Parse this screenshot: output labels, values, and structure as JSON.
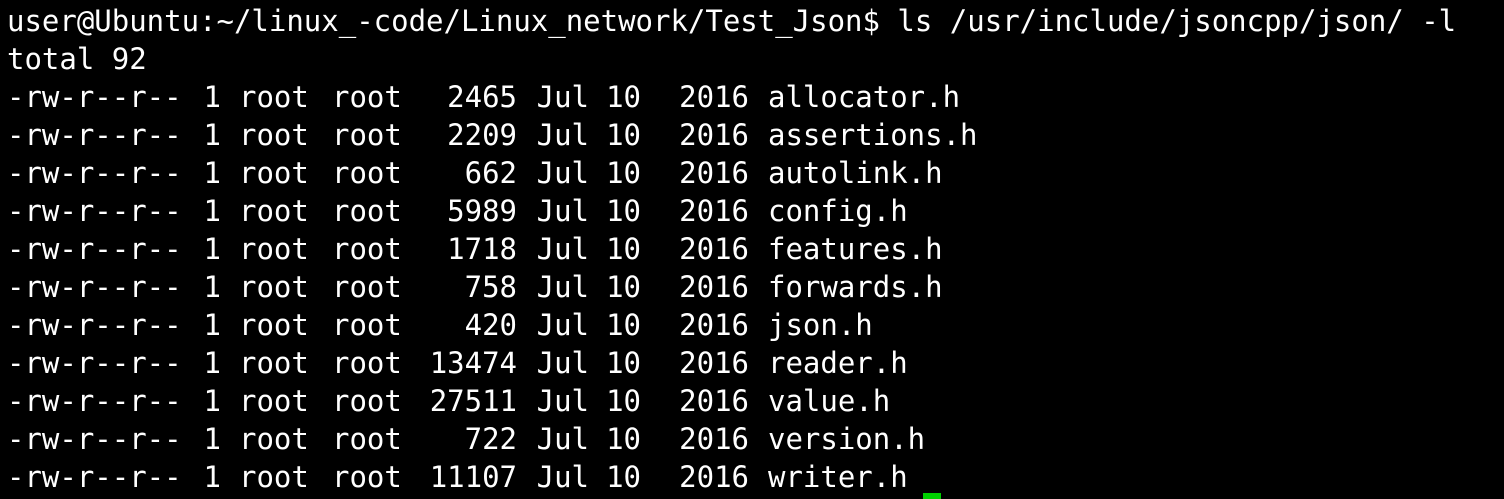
{
  "terminal": {
    "command_line": "user@Ubuntu:~/linux_-code/Linux_network/Test_Json$ ls /usr/include/jsoncpp/json/ -l",
    "total_line": "total 92",
    "cursor_color": "#00d000",
    "text_color": "#ffffff",
    "background_color": "#000000",
    "entries": [
      {
        "perm": "-rw-r--r--",
        "links": "1",
        "owner": "root",
        "group": "root",
        "size": "2465",
        "month": "Jul",
        "day": "10",
        "year": "2016",
        "name": "allocator.h"
      },
      {
        "perm": "-rw-r--r--",
        "links": "1",
        "owner": "root",
        "group": "root",
        "size": "2209",
        "month": "Jul",
        "day": "10",
        "year": "2016",
        "name": "assertions.h"
      },
      {
        "perm": "-rw-r--r--",
        "links": "1",
        "owner": "root",
        "group": "root",
        "size": "662",
        "month": "Jul",
        "day": "10",
        "year": "2016",
        "name": "autolink.h"
      },
      {
        "perm": "-rw-r--r--",
        "links": "1",
        "owner": "root",
        "group": "root",
        "size": "5989",
        "month": "Jul",
        "day": "10",
        "year": "2016",
        "name": "config.h"
      },
      {
        "perm": "-rw-r--r--",
        "links": "1",
        "owner": "root",
        "group": "root",
        "size": "1718",
        "month": "Jul",
        "day": "10",
        "year": "2016",
        "name": "features.h"
      },
      {
        "perm": "-rw-r--r--",
        "links": "1",
        "owner": "root",
        "group": "root",
        "size": "758",
        "month": "Jul",
        "day": "10",
        "year": "2016",
        "name": "forwards.h"
      },
      {
        "perm": "-rw-r--r--",
        "links": "1",
        "owner": "root",
        "group": "root",
        "size": "420",
        "month": "Jul",
        "day": "10",
        "year": "2016",
        "name": "json.h"
      },
      {
        "perm": "-rw-r--r--",
        "links": "1",
        "owner": "root",
        "group": "root",
        "size": "13474",
        "month": "Jul",
        "day": "10",
        "year": "2016",
        "name": "reader.h"
      },
      {
        "perm": "-rw-r--r--",
        "links": "1",
        "owner": "root",
        "group": "root",
        "size": "27511",
        "month": "Jul",
        "day": "10",
        "year": "2016",
        "name": "value.h"
      },
      {
        "perm": "-rw-r--r--",
        "links": "1",
        "owner": "root",
        "group": "root",
        "size": "722",
        "month": "Jul",
        "day": "10",
        "year": "2016",
        "name": "version.h"
      },
      {
        "perm": "-rw-r--r--",
        "links": "1",
        "owner": "root",
        "group": "root",
        "size": "11107",
        "month": "Jul",
        "day": "10",
        "year": "2016",
        "name": "writer.h"
      }
    ]
  }
}
